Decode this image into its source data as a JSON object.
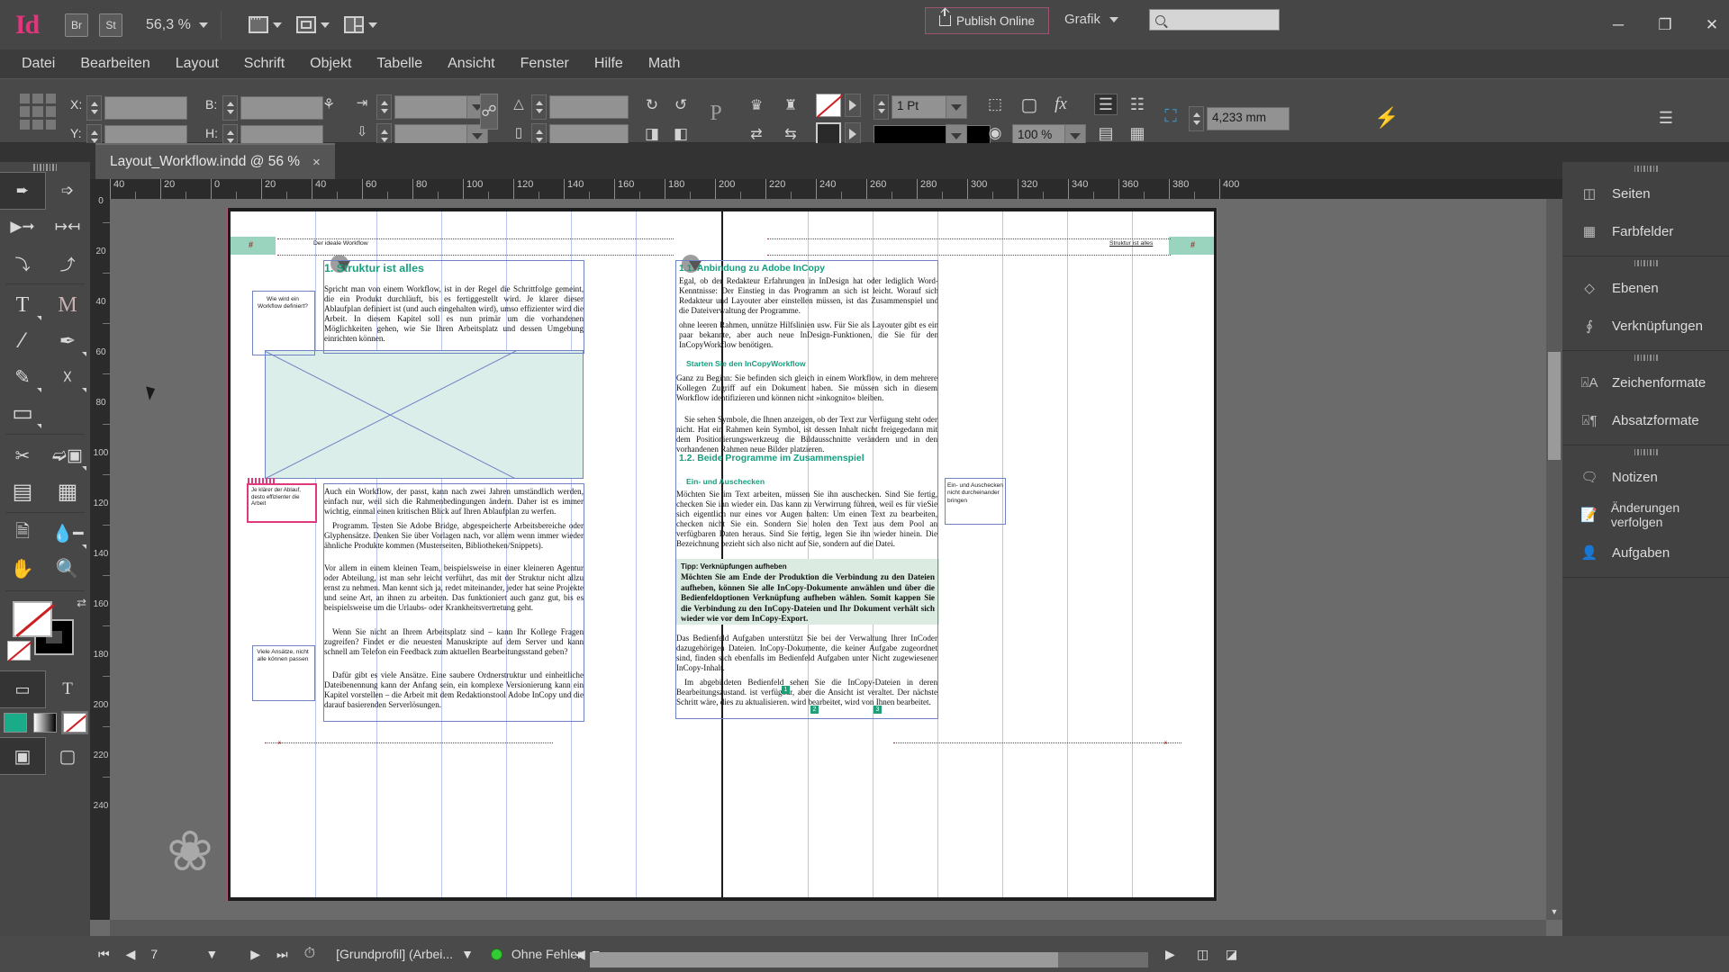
{
  "app": {
    "logo": "Id",
    "bridge_label": "Br",
    "stock_label": "St",
    "zoom_level": "56,3 %",
    "publish_button": "Publish Online",
    "workspace": "Grafik",
    "search_placeholder": "",
    "window_minimize": "─",
    "window_restore": "❐",
    "window_close": "✕"
  },
  "menu": [
    "Datei",
    "Bearbeiten",
    "Layout",
    "Schrift",
    "Objekt",
    "Tabelle",
    "Ansicht",
    "Fenster",
    "Hilfe",
    "Math"
  ],
  "control": {
    "x_label": "X:",
    "x_value": "",
    "y_label": "Y:",
    "y_value": "",
    "w_label": "B:",
    "w_value": "",
    "h_label": "H:",
    "h_value": "",
    "scale_x": "",
    "scale_y": "",
    "rotate": "",
    "shear": "",
    "stroke_weight": "1 Pt",
    "opacity": "100 %",
    "corner_radius": "4,233 mm"
  },
  "tab": {
    "title": "Layout_Workflow.indd @ 56 %",
    "close": "×"
  },
  "tools": {
    "collapse": "«",
    "items": [
      {
        "name": "selection-tool",
        "glyph": "⬈",
        "selected": true
      },
      {
        "name": "direct-selection-tool",
        "glyph": "⬉",
        "selected": false
      },
      {
        "name": "page-tool",
        "glyph": "⬊",
        "selected": false
      },
      {
        "name": "gap-tool",
        "glyph": "↔",
        "selected": false
      },
      {
        "name": "content-collector-tool",
        "glyph": "⤵",
        "selected": false
      },
      {
        "name": "content-placer-tool",
        "glyph": "⤴",
        "selected": false
      },
      {
        "name": "type-tool",
        "glyph": "T",
        "selected": false
      },
      {
        "name": "type-on-path-tool",
        "glyph": "M",
        "selected": false
      },
      {
        "name": "line-tool",
        "glyph": "╱",
        "selected": false
      },
      {
        "name": "pen-tool",
        "glyph": "✒",
        "selected": false
      },
      {
        "name": "pencil-tool",
        "glyph": "✎",
        "selected": false
      },
      {
        "name": "rectangle-frame-tool",
        "glyph": "⌧",
        "selected": false
      },
      {
        "name": "rectangle-tool",
        "glyph": "▭",
        "selected": false
      },
      {
        "name": "scissors-tool",
        "glyph": "✂",
        "selected": false
      },
      {
        "name": "free-transform-tool",
        "glyph": "⬚",
        "selected": false
      },
      {
        "name": "gradient-swatch-tool",
        "glyph": "▤",
        "selected": false
      },
      {
        "name": "gradient-feather-tool",
        "glyph": "▦",
        "selected": false
      },
      {
        "name": "note-tool",
        "glyph": "☰",
        "selected": false
      },
      {
        "name": "eyedropper-tool",
        "glyph": "⚗",
        "selected": false
      },
      {
        "name": "hand-tool",
        "glyph": "✋",
        "selected": false
      },
      {
        "name": "zoom-tool",
        "glyph": "⌕",
        "selected": false
      }
    ],
    "apply_frame": "▢",
    "apply_text": "T",
    "swatch_color": "#1aab89",
    "swatch_gradient": "gradient",
    "swatch_none": "none",
    "view_normal": "▣",
    "view_preview": "□"
  },
  "dock": {
    "groups": [
      {
        "items": [
          {
            "label": "Seiten",
            "icon": "pages-icon"
          },
          {
            "label": "Farbfelder",
            "icon": "swatches-icon"
          }
        ]
      },
      {
        "items": [
          {
            "label": "Ebenen",
            "icon": "layers-icon"
          },
          {
            "label": "Verknüpfungen",
            "icon": "links-icon"
          }
        ]
      },
      {
        "items": [
          {
            "label": "Zeichenformate",
            "icon": "character-styles-icon"
          },
          {
            "label": "Absatzformate",
            "icon": "paragraph-styles-icon"
          }
        ]
      },
      {
        "items": [
          {
            "label": "Notizen",
            "icon": "notes-icon"
          },
          {
            "label": "Änderungen verfolgen",
            "icon": "track-changes-icon"
          },
          {
            "label": "Aufgaben",
            "icon": "assignments-icon"
          }
        ]
      }
    ]
  },
  "rulers": {
    "h_ticks": [
      "40",
      "20",
      "0",
      "20",
      "40",
      "60",
      "80",
      "100",
      "120",
      "140",
      "160",
      "180",
      "200",
      "220",
      "240",
      "260",
      "280",
      "300",
      "320",
      "340",
      "360",
      "380",
      "400"
    ],
    "v_ticks": [
      "0",
      "20",
      "40",
      "60",
      "80",
      "100",
      "120",
      "140",
      "160",
      "180",
      "200",
      "220",
      "240"
    ],
    "unit": "mm"
  },
  "document": {
    "running_head_left": "Der ideale Workflow",
    "running_head_right": "Struktur ist alles",
    "page_marker": "#",
    "left_page": {
      "heading1": "1.  Struktur ist alles",
      "marginal1": "Wie wird ein Workflow definiert?",
      "para1": "Spricht man von einem Workflow, ist in der Regel die Schrittfolge gemeint, die ein Produkt durchläuft, bis es fertiggestellt wird. Je klarer dieser Ablaufplan definiert ist (und auch eingehalten wird), umso effizienter wird die Arbeit. In diesem Kapitel soll es nun primär um die vorhandenen Möglichkeiten gehen, wie Sie Ihren Arbeitsplatz und dessen Umgebung einrichten können.",
      "note_text": "Je klärer der Ablauf, desto effizienter die Arbeit",
      "para2": "Auch ein Workflow, der passt, kann nach zwei Jahren umständlich werden, einfach nur, weil sich die Rahmenbedingungen ändern. Daher ist es immer wichtig, einmal einen kritischen Blick auf Ihren Ablaufplan zu werfen.",
      "para3": "Programm. Testen Sie Adobe Bridge, abgespeicherte Arbeitsbereiche oder Glyphensätze. Denken Sie über Vorlagen nach, vor allem wenn immer wieder ähnliche Produkte kommen (Musterseiten, Bibliotheken/Snippets).",
      "para4": "Vor allem in einem kleinen Team, beispielsweise in einer kleineren Agentur oder Abteilung, ist man sehr leicht verführt, das mit der Struktur nicht allzu ernst zu nehmen. Man kennt sich ja, redet miteinander, jeder hat seine Projekte und seine Art, an ihnen zu arbeiten. Das funktioniert auch ganz gut, bis es beispielsweise um die Urlaubs- oder Krankheitsvertretung geht.",
      "para5": "Wenn Sie nicht an Ihrem Arbeitsplatz sind – kann Ihr Kollege Fragen zugreifen? Findet er die neuesten Manuskripte auf dem Server und kann schnell am Telefon ein Feedback zum aktuellen Bearbeitungsstand geben?",
      "marginal2": "Viele Ansätze, nicht alle können passen",
      "para6": "Dafür gibt es viele Ansätze. Eine saubere Ordnerstruktur und einheitliche Dateibenennung kann der Anfang sein, ein komplexe Versionierung kann ein Kapitel vorstellen – die Arbeit mit dem Redaktionstool Adobe InCopy und die darauf basierenden Serverlösungen."
    },
    "right_page": {
      "heading1": "1.1.   Anbindung zu Adobe InCopy",
      "para1": "Egal, ob der Redakteur Erfahrungen in InDesign hat oder lediglich Word-Kenntnisse: Der Einstieg in das Programm an sich ist leicht. Worauf sich Redakteur und Layouter aber einstellen müssen, ist das Zusammenspiel und die Dateiverwaltung der Programme.",
      "para2": "ohne leeren Rahmen, unnütze Hilfslinien usw. Für Sie als Layouter gibt es ein paar bekannte, aber auch neue InDesign-Funktionen, die Sie für den InCopyWorkflow benötigen.",
      "heading2": "Starten Sie den InCopyWorkflow",
      "para3": "Ganz zu Beginn: Sie befinden sich gleich in einem Workflow, in dem mehrere Kollegen Zugriff auf ein Dokument haben. Sie müssen sich in diesem Workflow identifizieren und können nicht »inkognito« bleiben.",
      "para4": "Sie sehen Symbole, die Ihnen anzeigen, ob der Text zur Verfügung steht oder nicht. Hat ein Rahmen kein Symbol, ist dessen Inhalt nicht freigegedann mit dem Positionierungswerkzeug die Bildausschnitte verändern und in den vorhandenen Rahmen neue Bilder platzieren.",
      "heading3": "1.2.   Beide Programme im Zusammenspiel",
      "heading4": "Ein- und Auschecken",
      "para5": "Möchten Sie im Text arbeiten, müssen Sie ihn auschecken. Sind Sie fertig, checken Sie ihn wieder ein. Das kann zu Verwirrung führen, weil es für vieSie sich eigentlich nur eines vor Augen halten: Um einen Text zu bearbeiten, checken nicht Sie ein. Sondern Sie holen den Text aus dem Pool an verfügbaren Daten heraus. Sind Sie fertig, legen Sie ihn wieder hinein. Die Bezeichnung bezieht sich also nicht auf Sie, sondern auf die Datei.",
      "marginal1": "Ein- und Auschecken nicht durcheinander bringen",
      "tip_title": "Tipp: Verknüpfungen aufheben",
      "tip_text": "Möchten Sie am Ende der Produktion die Verbindung zu den Dateien aufheben, können Sie alle InCopy-Dokumente anwählen und über die Bedienfeldoptionen Verknüpfung aufheben wählen. Somit kappen Sie die Verbindung zu den InCopy-Dateien und Ihr Dokument verhält sich wieder wie vor dem InCopy-Export.",
      "para6": "Das Bedienfeld Aufgaben unterstützt Sie bei der Verwaltung Ihrer InCoder dazugehörigen Dateien. InCopy-Dokumente, die keiner Aufgabe zugeordnet sind, finden sich ebenfalls im Bedienfeld Aufgaben unter Nicht zugewiesener InCopy-Inhalt.",
      "para7": "Im abgebildeten Bedienfeld sehen Sie die InCopy-Dateien in deren Bearbeitungszustand.  ist verfügbar, aber die Ansicht ist veraltet. Der nächste Schritt wäre, dies zu aktualisieren.  wird bearbeitet,  wird von Ihnen bearbeitet.",
      "badge1": "1",
      "badge2": "2",
      "badge3": "3"
    }
  },
  "status": {
    "first_page": "⏮",
    "prev_page": "◀",
    "page_number": "7",
    "page_caret": "▼",
    "next_page": "▶",
    "last_page": "⏭",
    "preflight_profile": "[Grundprofil] (Arbei...",
    "error_status": "Ohne Fehler",
    "error_caret": "▼"
  }
}
